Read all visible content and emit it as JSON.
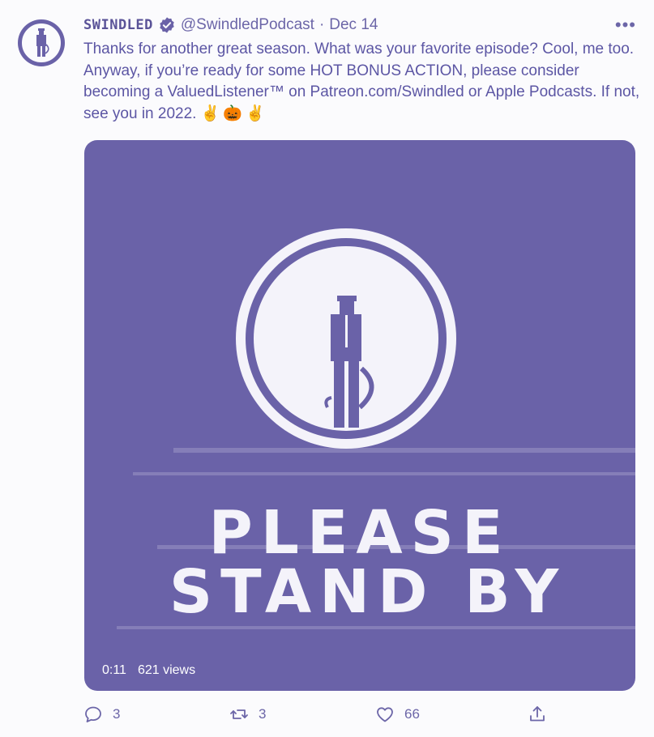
{
  "tweet": {
    "display_name": "SWINDLED",
    "handle": "@SwindledPodcast",
    "separator": "·",
    "date": "Dec 14",
    "more_label": "•••",
    "text": "Thanks for another great season. What was your favorite episode? Cool, me too. Anyway, if you’re ready for some HOT BONUS ACTION, please consider becoming a ValuedListener™ on Patreon.com/Swindled or Apple Podcasts. If not, see you in 2022.",
    "emojis": "✌️🎃✌️"
  },
  "media": {
    "line1": "PLEASE",
    "line2": "STAND BY",
    "time": "0:11",
    "views": "621 views"
  },
  "actions": {
    "replies": "3",
    "retweets": "3",
    "likes": "66"
  },
  "colors": {
    "accent": "#6a62a8",
    "background": "#fbfbfd",
    "text": "#5c56a4"
  },
  "icons": {
    "avatar": "man-silhouette-icon",
    "verified": "verified-badge-icon",
    "reply": "reply-icon",
    "retweet": "retweet-icon",
    "like": "heart-icon",
    "share": "share-icon"
  }
}
